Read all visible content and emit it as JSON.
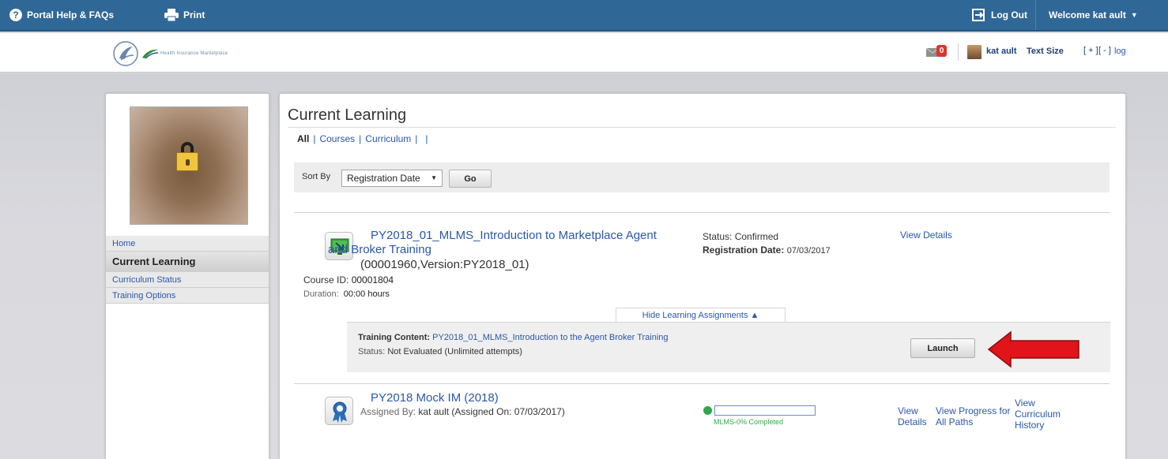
{
  "topbar": {
    "help_label": "Portal Help & FAQs",
    "print_label": "Print",
    "logout_label": "Log Out",
    "welcome_label": "Welcome kat ault"
  },
  "header": {
    "marketplace_text": "Health Insurance Marketplace",
    "mail_count": "0",
    "user_name": "kat ault",
    "text_size_label": "Text Size",
    "size_plus": "[ + ]",
    "size_minus": "[ - ]",
    "log_label": "log"
  },
  "sidebar": {
    "items": [
      {
        "label": "Home"
      },
      {
        "label": "Current Learning"
      },
      {
        "label": "Curriculum Status"
      },
      {
        "label": "Training Options"
      }
    ]
  },
  "main": {
    "title": "Current Learning",
    "filters": [
      "All",
      "Courses",
      "Curriculum"
    ],
    "sort": {
      "label": "Sort By",
      "selected": "Registration Date",
      "go_label": "Go"
    },
    "course1": {
      "title_line1": "PY2018_01_MLMS_Introduction to Marketplace Agent",
      "title_line2": "and Broker Training",
      "version": "(00001960,Version:PY2018_01)",
      "course_id_label": "Course ID:",
      "course_id": "00001804",
      "duration_label": "Duration:",
      "duration": "00:00 hours",
      "status": "Status: Confirmed",
      "reg_label": "Registration Date:",
      "reg_date": "07/03/2017",
      "view_details": "View Details",
      "hide_assignments": "Hide Learning Assignments ▲",
      "training_content_label": "Training Content:",
      "training_content": "PY2018_01_MLMS_Introduction to the Agent Broker Training",
      "assignment_status_label": "Status:",
      "assignment_status": "Not Evaluated (Unlimited attempts)",
      "launch_label": "Launch"
    },
    "course2": {
      "title": "PY2018 Mock IM (2018)",
      "assigned_label": "Assigned By:",
      "assigned_value": "kat ault (Assigned On: 07/03/2017)",
      "progress_label": "MLMS-0% Completed",
      "progress_fraction": 0.0,
      "view_details": "View Details",
      "view_progress": "View Progress for All Paths",
      "view_history": "View Curriculum History"
    }
  },
  "colors": {
    "topbar": "#2f6797",
    "link": "#2a57a8",
    "arrow": "#e0141a"
  }
}
